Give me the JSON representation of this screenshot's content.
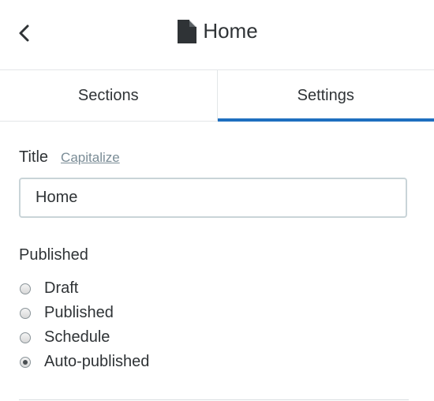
{
  "header": {
    "title": "Home",
    "back_icon": "chevron-left-icon",
    "page_icon": "document-icon"
  },
  "tabs": [
    {
      "label": "Sections",
      "active": false
    },
    {
      "label": "Settings",
      "active": true
    }
  ],
  "title_field": {
    "label": "Title",
    "capitalize_label": "Capitalize",
    "value": "Home"
  },
  "published": {
    "label": "Published",
    "options": [
      {
        "label": "Draft",
        "checked": false
      },
      {
        "label": "Published",
        "checked": false
      },
      {
        "label": "Schedule",
        "checked": false
      },
      {
        "label": "Auto-published",
        "checked": true
      }
    ]
  },
  "colors": {
    "accent": "#1e6fbf",
    "text": "#2f3336",
    "muted_link": "#7a8c96",
    "border": "#c9d4d8"
  }
}
